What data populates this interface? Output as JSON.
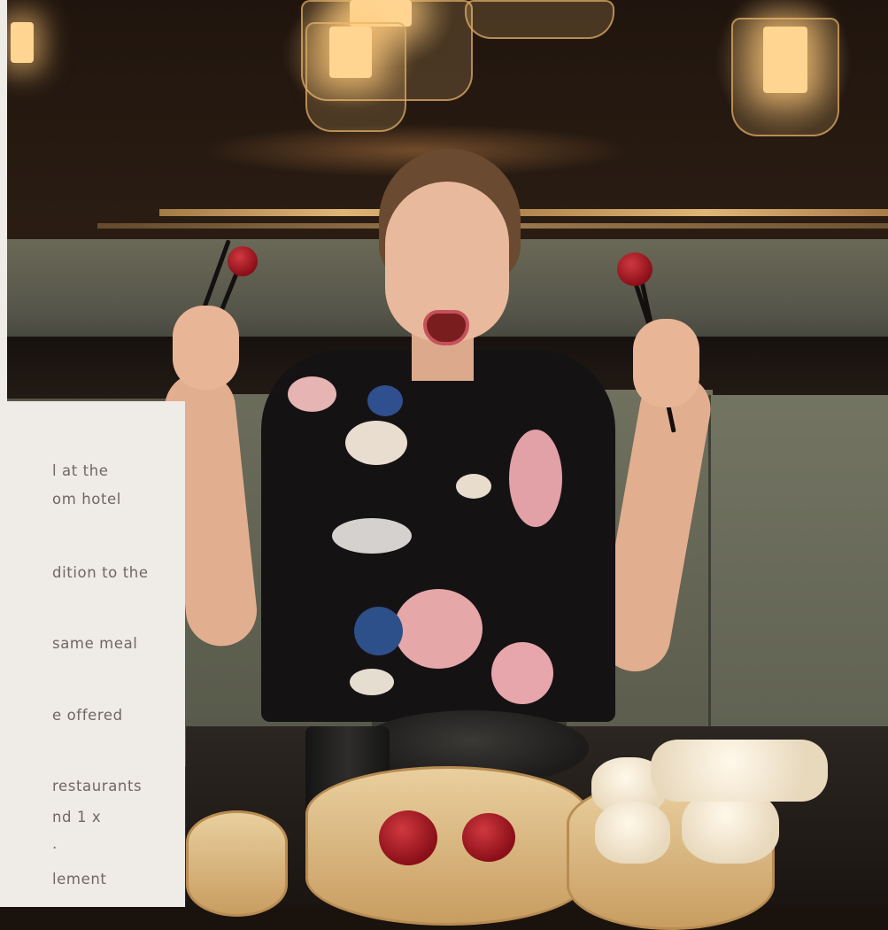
{
  "text_panel": {
    "lines": [
      "l at the",
      "om hotel",
      "dition to the",
      "same meal",
      "e offered",
      "restaurants",
      "nd 1 x",
      ".",
      "lement"
    ]
  }
}
